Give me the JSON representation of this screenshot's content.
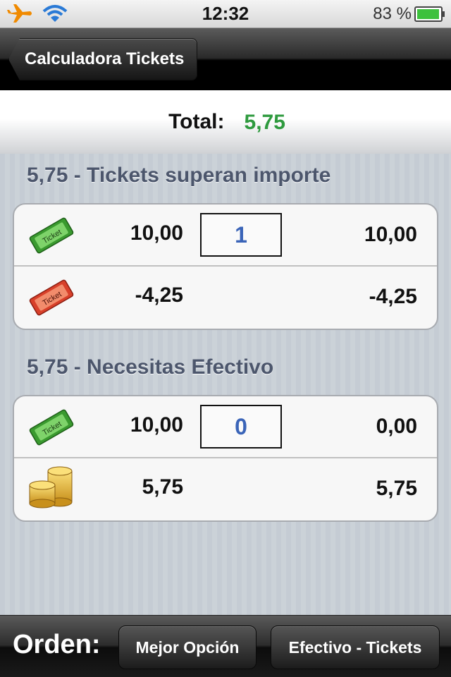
{
  "status_bar": {
    "time": "12:32",
    "battery_percent": "83 %"
  },
  "nav": {
    "back_label": "Calculadora Tickets"
  },
  "total": {
    "label": "Total:",
    "value": "5,75"
  },
  "sections": [
    {
      "header": "5,75 - Tickets superan importe",
      "rows": [
        {
          "icon": "green-ticket-icon",
          "denomination": "10,00",
          "quantity": "1",
          "subtotal": "10,00"
        },
        {
          "icon": "red-ticket-icon",
          "denomination": "-4,25",
          "subtotal": "-4,25"
        }
      ]
    },
    {
      "header": "5,75 - Necesitas Efectivo",
      "rows": [
        {
          "icon": "green-ticket-icon",
          "denomination": "10,00",
          "quantity": "0",
          "subtotal": "0,00"
        },
        {
          "icon": "coins-icon",
          "denomination": "5,75",
          "subtotal": "5,75"
        }
      ]
    }
  ],
  "toolbar": {
    "label": "Orden:",
    "buttons": [
      "Mejor Opción",
      "Efectivo - Tickets"
    ]
  },
  "icon_text": {
    "ticket": "Ticket"
  },
  "colors": {
    "total_green": "#2e9a3e",
    "quantity_blue": "#3a64b8",
    "section_header": "#4c566c"
  }
}
